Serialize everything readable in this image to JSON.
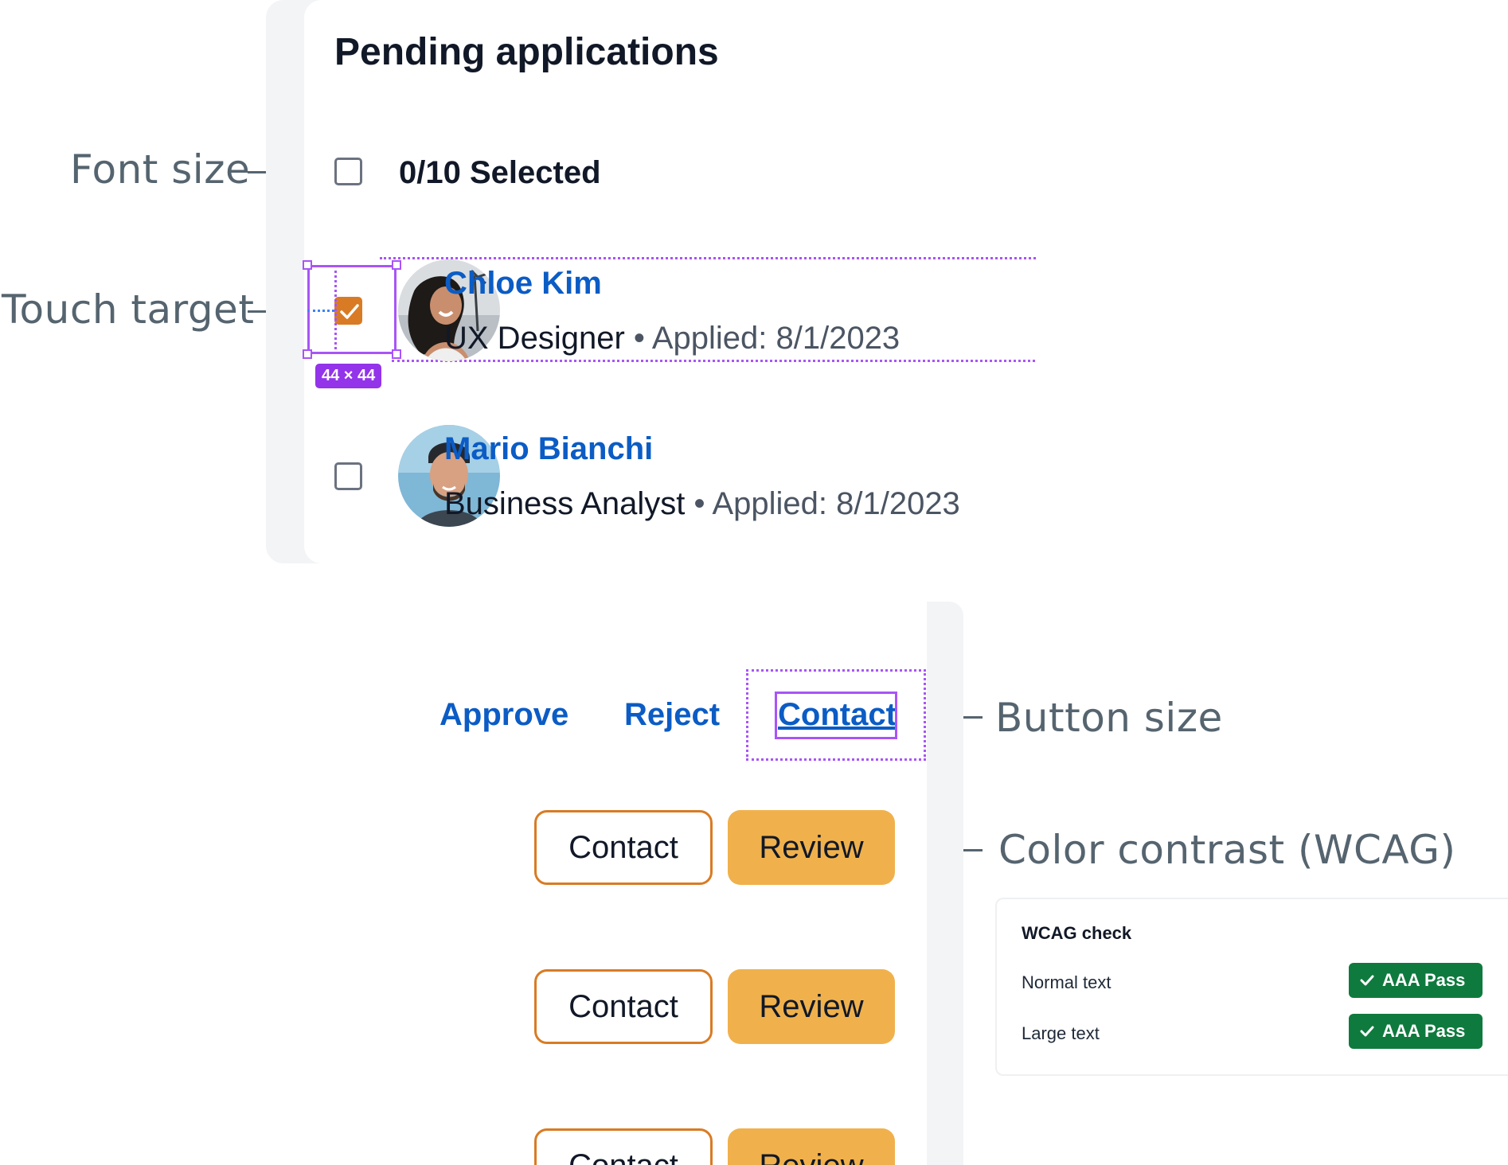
{
  "annotations": {
    "font_size": "Font size",
    "touch_target": "Touch target",
    "button_size": "Button size",
    "color_contrast": "Color contrast (WCAG)",
    "touch_size_badge": "44 × 44"
  },
  "applications": {
    "title": "Pending applications",
    "selected_count": "0/10 Selected",
    "items": [
      {
        "name": "Chloe Kim",
        "role": "UX Designer",
        "separator": "•",
        "applied": "Applied: 8/1/2023",
        "checked": true
      },
      {
        "name": "Mario Bianchi",
        "role": "Business Analyst",
        "separator": "•",
        "applied": "Applied: 8/1/2023",
        "checked": false
      }
    ]
  },
  "actions": {
    "approve": "Approve",
    "reject": "Reject",
    "contact": "Contact",
    "rows": [
      {
        "contact": "Contact",
        "review": "Review"
      },
      {
        "contact": "Contact",
        "review": "Review"
      },
      {
        "contact": "Contact",
        "review": "Review"
      }
    ]
  },
  "wcag": {
    "title": "WCAG check",
    "checks": [
      {
        "label": "Normal text",
        "result": "AAA Pass"
      },
      {
        "label": "Large text",
        "result": "AAA Pass"
      }
    ]
  },
  "colors": {
    "accent_orange": "#d97b24",
    "review_fill": "#f0b14c",
    "link_blue": "#0b5cc5",
    "annotation_purple": "#a855f7",
    "pass_green": "#0f7a3e"
  }
}
